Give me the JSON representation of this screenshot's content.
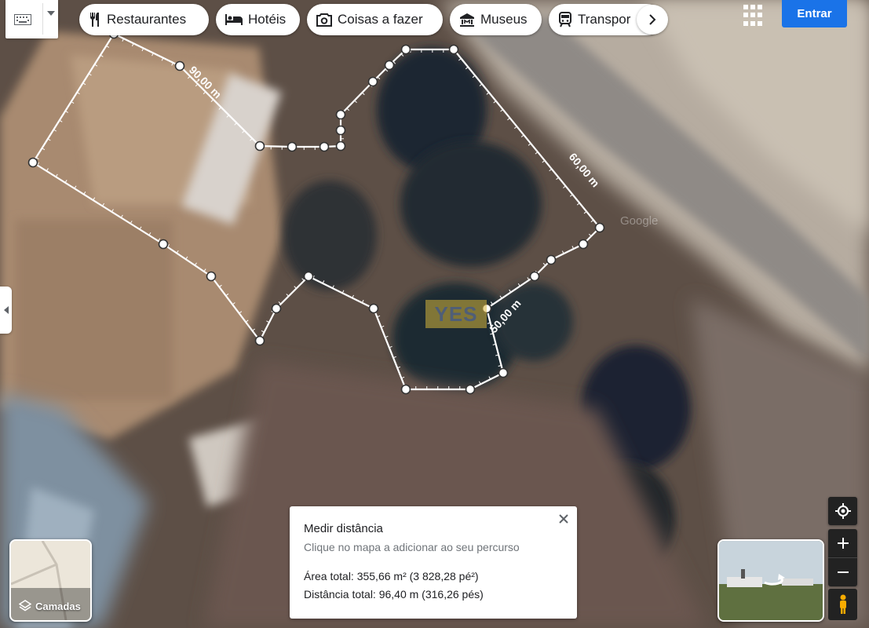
{
  "top_bar": {
    "categories": [
      {
        "label": "Restaurantes",
        "icon": "restaurant-icon"
      },
      {
        "label": "Hotéis",
        "icon": "hotel-icon"
      },
      {
        "label": "Coisas a fazer",
        "icon": "camera-icon"
      },
      {
        "label": "Museus",
        "icon": "museum-icon"
      },
      {
        "label": "Transpor",
        "icon": "transit-icon"
      }
    ],
    "sign_in_label": "Entrar"
  },
  "measurement": {
    "segment_labels": [
      "90,00 m",
      "60,00 m",
      "50,00 m"
    ],
    "map_watermark": "Google"
  },
  "measure_panel": {
    "title": "Medir distância",
    "hint": "Clique no mapa a adicionar ao seu percurso",
    "area_text": "Área total: 355,66 m² (3 828,28 pé²)",
    "distance_text": "Distância total: 96,40 m (316,26 pés)"
  },
  "layers": {
    "label": "Camadas"
  },
  "watermark_text": "YES",
  "colors": {
    "accent": "#1a73e8",
    "path": "#ffffff"
  }
}
